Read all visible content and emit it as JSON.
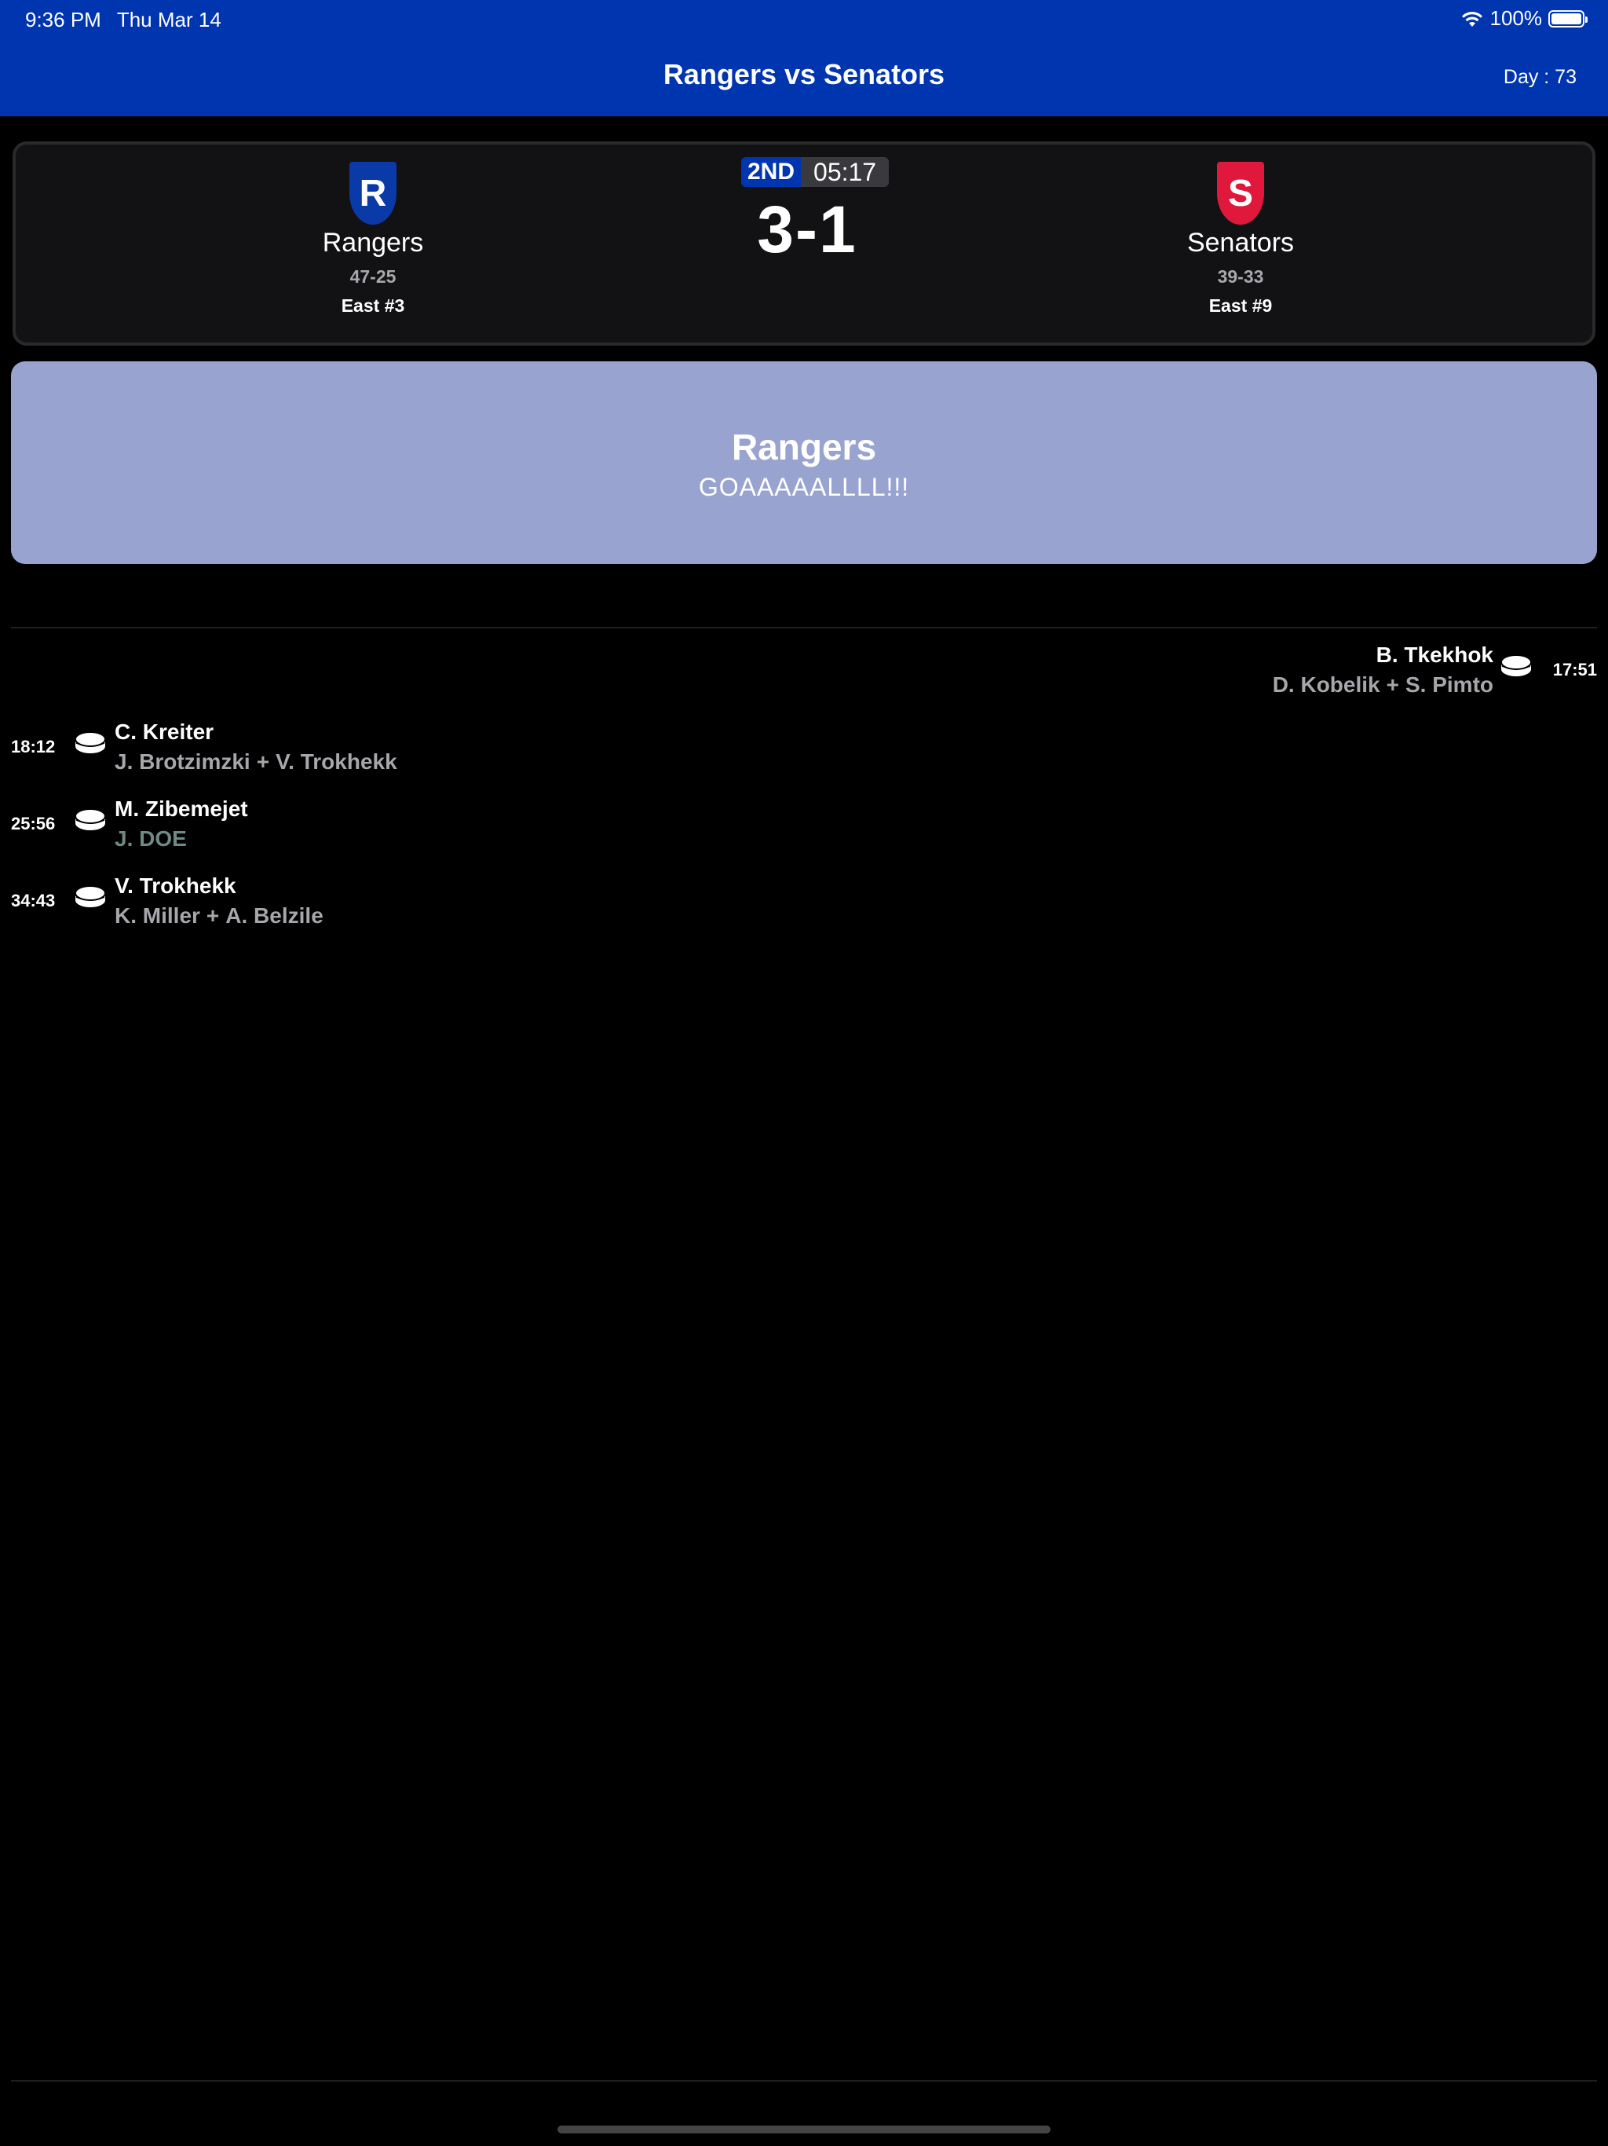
{
  "status_bar": {
    "time": "9:36 PM",
    "date": "Thu Mar 14",
    "battery": "100%"
  },
  "nav": {
    "title": "Rangers vs Senators",
    "day": "Day : 73"
  },
  "colors": {
    "header": "#0035b0",
    "home": "#0a3aa8",
    "away": "#e0193c",
    "banner": "#99a3cf"
  },
  "game": {
    "period": "2ND",
    "clock": "05:17",
    "score": "3-1",
    "home": {
      "letter": "R",
      "name": "Rangers",
      "record": "47-25",
      "rank": "East #3"
    },
    "away": {
      "letter": "S",
      "name": "Senators",
      "record": "39-33",
      "rank": "East #9"
    }
  },
  "goal_banner": {
    "team": "Rangers",
    "text": "GOAAAAALLLL!!!"
  },
  "events": [
    {
      "side": "away",
      "time": "17:51",
      "scorer": "B. Tkekhok",
      "assist1": "D. Kobelik",
      "plus": "+",
      "assist2": "S. Pimto",
      "icon": "puck-icon"
    },
    {
      "side": "home",
      "time": "18:12",
      "scorer": "C. Kreiter",
      "assist1": "J. Brotzimzki",
      "plus": "+",
      "assist2": "V. Trokhekk",
      "icon": "puck-icon"
    },
    {
      "side": "home",
      "time": "25:56",
      "scorer": "M. Zibemejet",
      "assist1": "J. DOE",
      "icon": "puck-icon"
    },
    {
      "side": "home",
      "time": "34:43",
      "scorer": "V. Trokhekk",
      "assist1": "K. Miller",
      "plus": "+",
      "assist2": "A. Belzile",
      "icon": "puck-icon"
    }
  ]
}
